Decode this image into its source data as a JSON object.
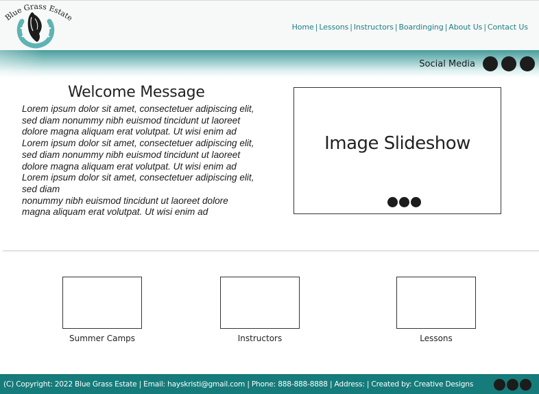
{
  "brand": {
    "name": "Blue Grass Estate",
    "accent_color": "#1f7f80",
    "footer_color": "#167b7b"
  },
  "nav": {
    "items": [
      {
        "label": "Home"
      },
      {
        "label": "Lessons"
      },
      {
        "label": "Instructors"
      },
      {
        "label": "Boardinging"
      },
      {
        "label": "About Us"
      },
      {
        "label": "Contact Us"
      }
    ],
    "separator": "|"
  },
  "social": {
    "label": "Social Media",
    "icons": [
      "social-icon-1",
      "social-icon-2",
      "social-icon-3"
    ]
  },
  "welcome": {
    "title": "Welcome Message",
    "lines": [
      "Lorem ipsum dolor sit amet, consectetuer adipiscing elit,",
      "sed diam nonummy nibh euismod tincidunt ut laoreet",
      "dolore magna aliquam erat volutpat. Ut wisi enim ad",
      "Lorem ipsum dolor sit amet, consectetuer adipiscing elit,",
      "sed diam nonummy nibh euismod tincidunt ut laoreet",
      "dolore magna aliquam erat volutpat. Ut wisi enim ad",
      "Lorem ipsum dolor sit amet, consectetuer adipiscing elit,",
      "sed diam",
      "nonummy nibh euismod tincidunt ut laoreet dolore",
      "magna aliquam erat volutpat. Ut wisi enim ad"
    ]
  },
  "slideshow": {
    "title": "Image Slideshow",
    "dots": 3
  },
  "cards": [
    {
      "label": "Summer Camps"
    },
    {
      "label": "Instructors"
    },
    {
      "label": "Lessons"
    }
  ],
  "footer": {
    "text": "(C) Copyright: 2022 Blue Grass Estate |  Email: hayskristi@gmail.com | Phone: 888-888-8888 | Address: | Created by: Creative Designs",
    "icons": [
      "footer-social-icon-1",
      "footer-social-icon-2",
      "footer-social-icon-3"
    ]
  }
}
